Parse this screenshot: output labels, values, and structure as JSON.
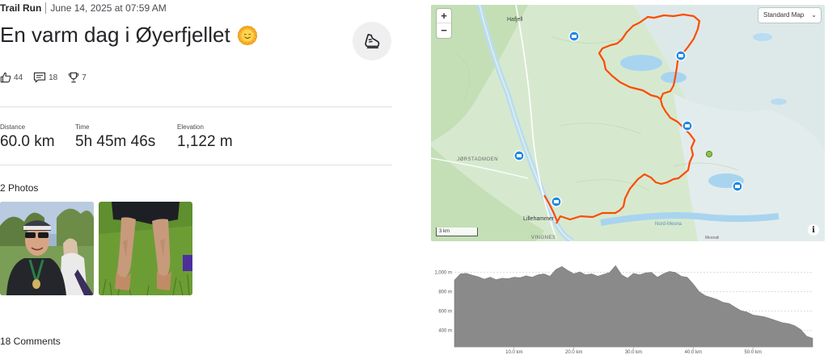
{
  "activity": {
    "type": "Trail Run",
    "date": "June 14, 2025 at 07:59 AM",
    "title": "En varm dag i Øyerfjellet"
  },
  "social": {
    "kudos": "44",
    "comments": "18",
    "achievements": "7"
  },
  "stats": [
    {
      "label": "Distance",
      "value": "60.0 km"
    },
    {
      "label": "Time",
      "value": "5h 45m 46s"
    },
    {
      "label": "Elevation",
      "value": "1,122 m"
    }
  ],
  "photos": {
    "heading": "2 Photos"
  },
  "comments_heading": "18 Comments",
  "map": {
    "zoom_in": "+",
    "zoom_out": "−",
    "style_select": "Standard Map",
    "scale_label": "3 km",
    "info": "i",
    "attribution": "Mesnali",
    "place_labels": [
      "Hafjell",
      "JØRSTADMOEN",
      "Lillehammer",
      "VINGNES",
      "Nord-Mesna"
    ]
  },
  "chart_data": {
    "type": "area",
    "title": "",
    "xlabel": "",
    "ylabel": "",
    "y_ticks": [
      "400 m",
      "600 m",
      "800 m",
      "1,000 m"
    ],
    "x_ticks": [
      "10.0 km",
      "20.0 km",
      "30.0 km",
      "40.0 km",
      "50.0 km"
    ],
    "xlim": [
      0,
      60
    ],
    "ylim": [
      230,
      1080
    ],
    "grid": true,
    "series": [
      {
        "color": "#8a8a8a",
        "x": [
          0,
          1,
          2,
          3,
          4,
          5,
          6,
          7,
          8,
          9,
          10,
          11,
          12,
          13,
          14,
          15,
          16,
          17,
          18,
          19,
          20,
          21,
          22,
          23,
          24,
          25,
          26,
          27,
          28,
          29,
          30,
          31,
          32,
          33,
          34,
          35,
          36,
          37,
          38,
          39,
          40,
          41,
          42,
          43,
          44,
          45,
          46,
          47,
          48,
          49,
          50,
          51,
          52,
          53,
          54,
          55,
          56,
          57,
          58,
          59,
          60
        ],
        "values": [
          920,
          985,
          990,
          970,
          955,
          930,
          950,
          925,
          940,
          935,
          950,
          945,
          965,
          950,
          975,
          985,
          960,
          1030,
          1060,
          1020,
          985,
          1005,
          975,
          985,
          960,
          980,
          1000,
          1070,
          975,
          940,
          990,
          975,
          995,
          1000,
          950,
          985,
          1010,
          1000,
          960,
          950,
          880,
          800,
          760,
          740,
          720,
          690,
          680,
          640,
          605,
          590,
          560,
          550,
          540,
          520,
          500,
          480,
          470,
          450,
          410,
          340,
          320
        ]
      }
    ]
  }
}
